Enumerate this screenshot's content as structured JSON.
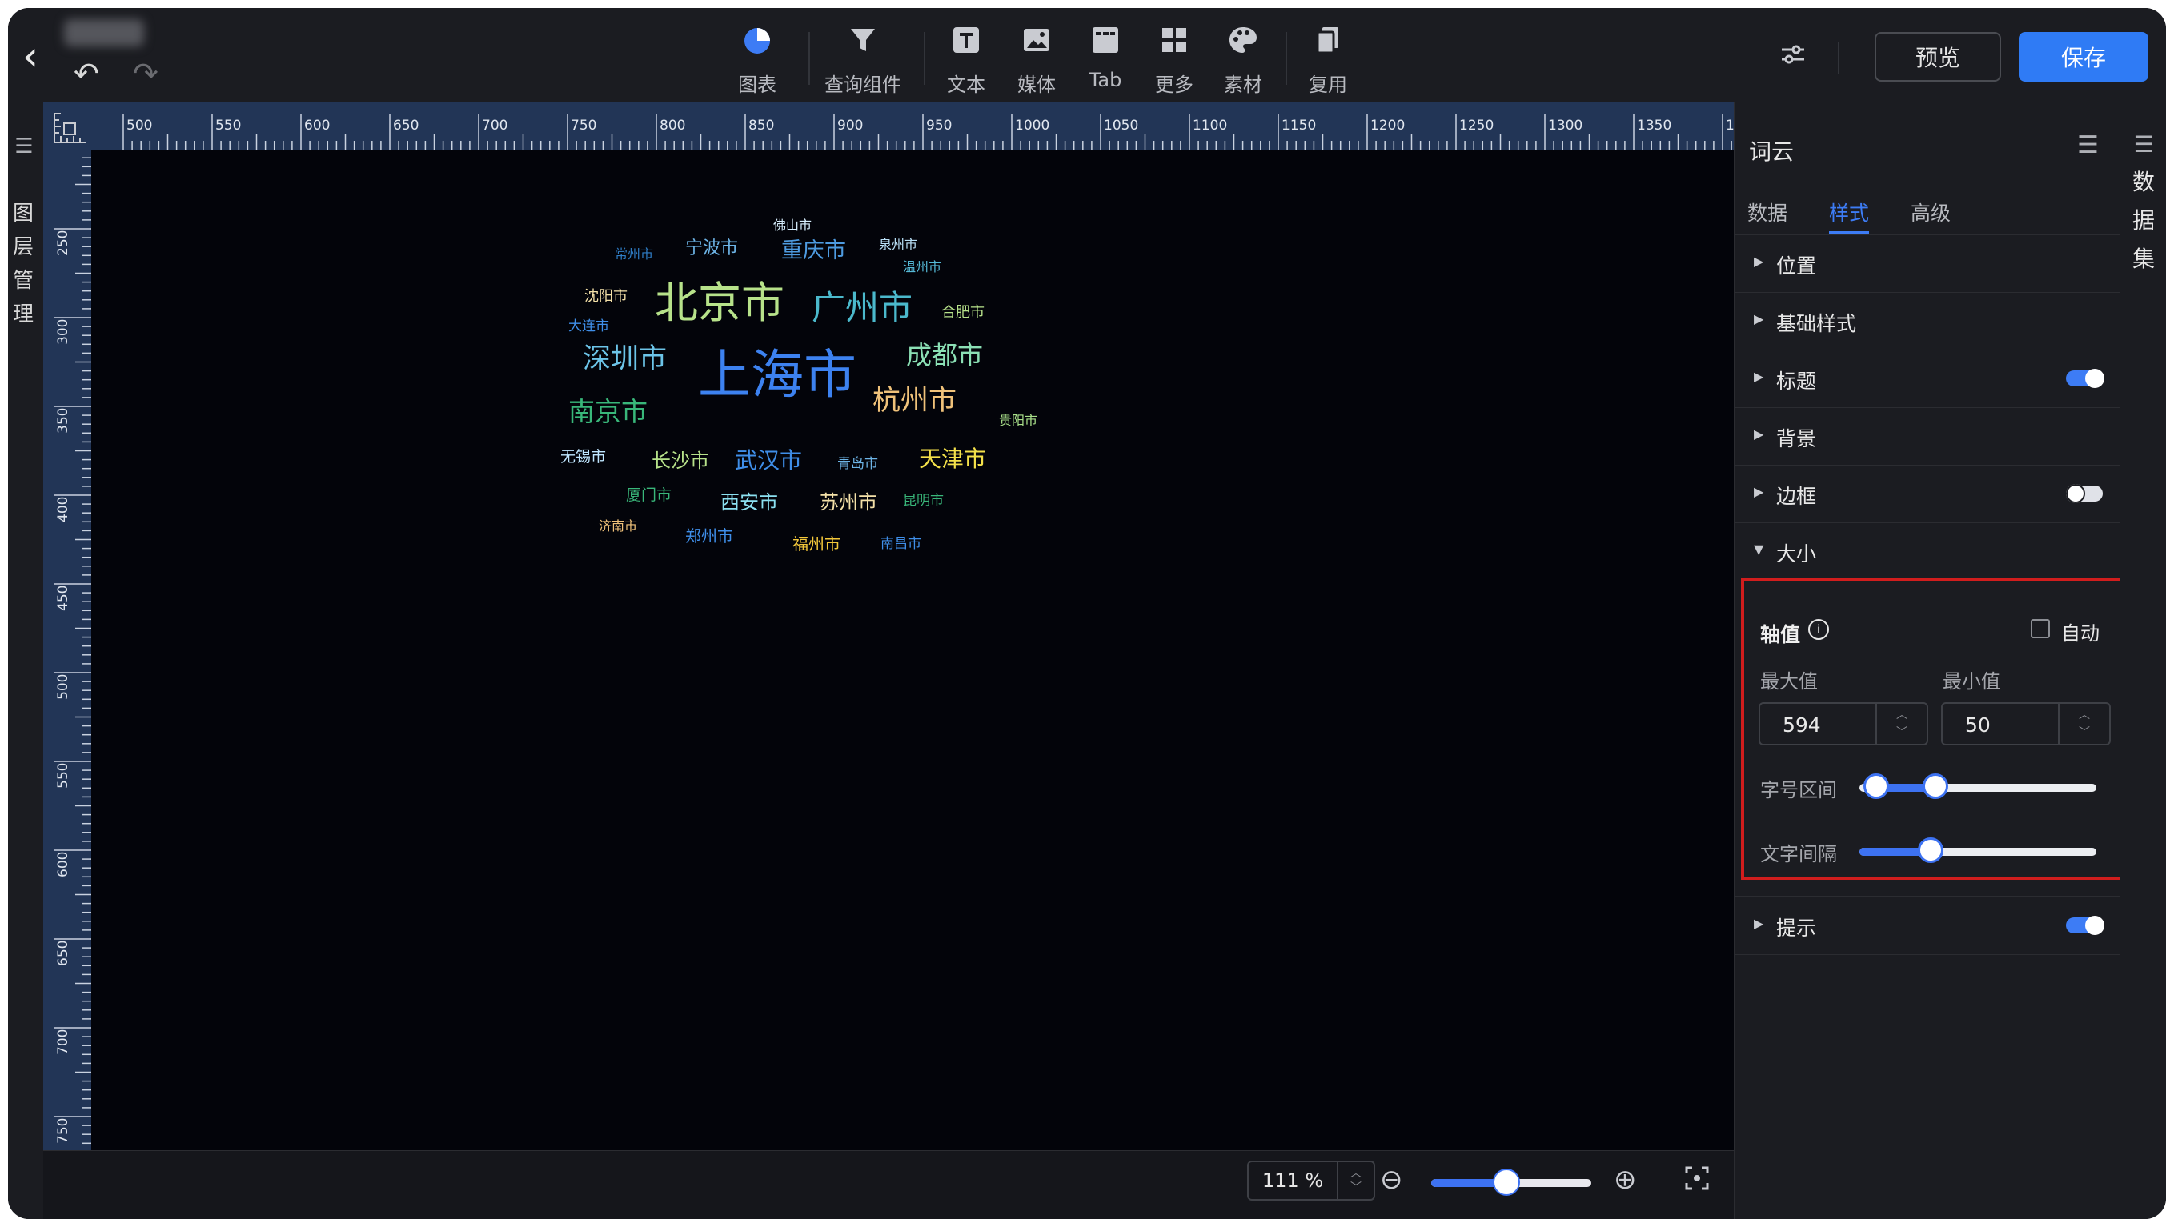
{
  "topbar": {
    "undo_icon": "undo-icon",
    "redo_icon": "redo-icon",
    "tools": [
      {
        "label": "图表",
        "icon": "pie-chart-icon"
      },
      {
        "label": "查询组件",
        "icon": "filter-icon"
      },
      {
        "label": "文本",
        "icon": "text-icon"
      },
      {
        "label": "媒体",
        "icon": "image-icon"
      },
      {
        "label": "Tab",
        "icon": "tab-icon"
      },
      {
        "label": "更多",
        "icon": "grid-icon"
      },
      {
        "label": "素材",
        "icon": "palette-icon"
      },
      {
        "label": "复用",
        "icon": "copy-icon"
      }
    ],
    "preview_label": "预览",
    "save_label": "保存"
  },
  "left_panel": {
    "label": "图层管理"
  },
  "right_strip": {
    "label": "数据集"
  },
  "ruler": {
    "h_ticks": [
      "500",
      "550",
      "600",
      "650",
      "700",
      "750",
      "800",
      "850",
      "900",
      "950",
      "1000",
      "1050",
      "1100",
      "1150",
      "1200",
      "1250",
      "1300",
      "1350",
      "14"
    ],
    "v_ticks": [
      "250",
      "300",
      "350",
      "400",
      "450",
      "500",
      "550",
      "600",
      "650",
      "700",
      "750"
    ]
  },
  "zoom": {
    "value": "111 %",
    "fraction": 0.47
  },
  "wordcloud": [
    {
      "text": "佛山市",
      "color": "#d8f0ff"
    },
    {
      "text": "常州市",
      "color": "#2f7ec7"
    },
    {
      "text": "宁波市",
      "color": "#6db4e6"
    },
    {
      "text": "重庆市",
      "color": "#4e9be0"
    },
    {
      "text": "泉州市",
      "color": "#b9e0f7"
    },
    {
      "text": "温州市",
      "color": "#55b9d6"
    },
    {
      "text": "沈阳市",
      "color": "#f3e0a8"
    },
    {
      "text": "北京市",
      "color": "#b7e28a"
    },
    {
      "text": "广州市",
      "color": "#4bb9cc"
    },
    {
      "text": "合肥市",
      "color": "#b7e28a"
    },
    {
      "text": "大连市",
      "color": "#3f8ee8"
    },
    {
      "text": "深圳市",
      "color": "#6cc4e8"
    },
    {
      "text": "上海市",
      "color": "#3d82f0"
    },
    {
      "text": "成都市",
      "color": "#8be0b5"
    },
    {
      "text": "南京市",
      "color": "#39b77a"
    },
    {
      "text": "杭州市",
      "color": "#f0c27a"
    },
    {
      "text": "贵阳市",
      "color": "#a9e08a"
    },
    {
      "text": "无锡市",
      "color": "#bfe6ff"
    },
    {
      "text": "长沙市",
      "color": "#b7e28a"
    },
    {
      "text": "武汉市",
      "color": "#3f8ee8"
    },
    {
      "text": "青岛市",
      "color": "#6db4e6"
    },
    {
      "text": "天津市",
      "color": "#f4e14a"
    },
    {
      "text": "厦门市",
      "color": "#39b77a"
    },
    {
      "text": "西安市",
      "color": "#8be0f0"
    },
    {
      "text": "苏州市",
      "color": "#f3e0a8"
    },
    {
      "text": "昆明市",
      "color": "#39b77a"
    },
    {
      "text": "济南市",
      "color": "#f0c27a"
    },
    {
      "text": "郑州市",
      "color": "#3f8ee8"
    },
    {
      "text": "福州市",
      "color": "#f4c83a"
    },
    {
      "text": "南昌市",
      "color": "#3f8ee8"
    }
  ],
  "panel": {
    "title": "词云",
    "tabs": [
      {
        "label": "数据",
        "active": false
      },
      {
        "label": "样式",
        "active": true
      },
      {
        "label": "高级",
        "active": false
      }
    ],
    "sections": [
      {
        "label": "位置"
      },
      {
        "label": "基础样式"
      },
      {
        "label": "标题",
        "toggle": true
      },
      {
        "label": "背景"
      },
      {
        "label": "边框",
        "toggle": false
      },
      {
        "label": "大小",
        "expanded": true
      },
      {
        "label": "提示",
        "toggle": true
      }
    ],
    "size": {
      "axis_label": "轴值",
      "auto_label": "自动",
      "auto_checked": false,
      "max_label": "最大值",
      "min_label": "最小值",
      "max_value": "594",
      "min_value": "50",
      "font_range_label": "字号区间",
      "font_range": [
        0.07,
        0.32
      ],
      "spacing_label": "文字间隔",
      "spacing": 0.3
    }
  },
  "colors": {
    "accent": "#2f7bf5",
    "highlight_border": "#d11d1d",
    "ruler": "#223556",
    "canvas": "#03040a"
  }
}
